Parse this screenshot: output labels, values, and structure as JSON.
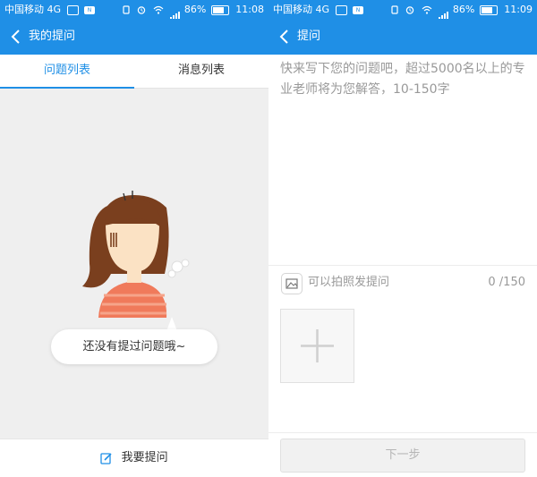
{
  "left_screen": {
    "statusbar": {
      "carrier": "中国移动 4G",
      "battery": "86%",
      "time": "11:08",
      "signal_label": "4G"
    },
    "header": {
      "title": "我的提问"
    },
    "tabs": [
      {
        "label": "问题列表",
        "active": true
      },
      {
        "label": "消息列表",
        "active": false
      }
    ],
    "empty_state": {
      "message": "还没有提过问题哦~"
    },
    "footer": {
      "ask_label": "我要提问"
    }
  },
  "right_screen": {
    "statusbar": {
      "carrier": "中国移动 4G",
      "battery": "86%",
      "time": "11:09",
      "signal_label": "4G"
    },
    "header": {
      "title": "提问"
    },
    "question_input": {
      "placeholder": "快来写下您的问题吧，超过5000名以上的专业老师将为您解答，10-150字",
      "value": ""
    },
    "photo": {
      "label": "可以拍照发提问",
      "counter": "0 /150"
    },
    "next_button": {
      "label": "下一步",
      "enabled": false
    }
  },
  "colors": {
    "brand_blue": "#1f8fe6",
    "hair": "#7a3f1e",
    "skin": "#fbe2c4",
    "shirt": "#f07a5b"
  }
}
